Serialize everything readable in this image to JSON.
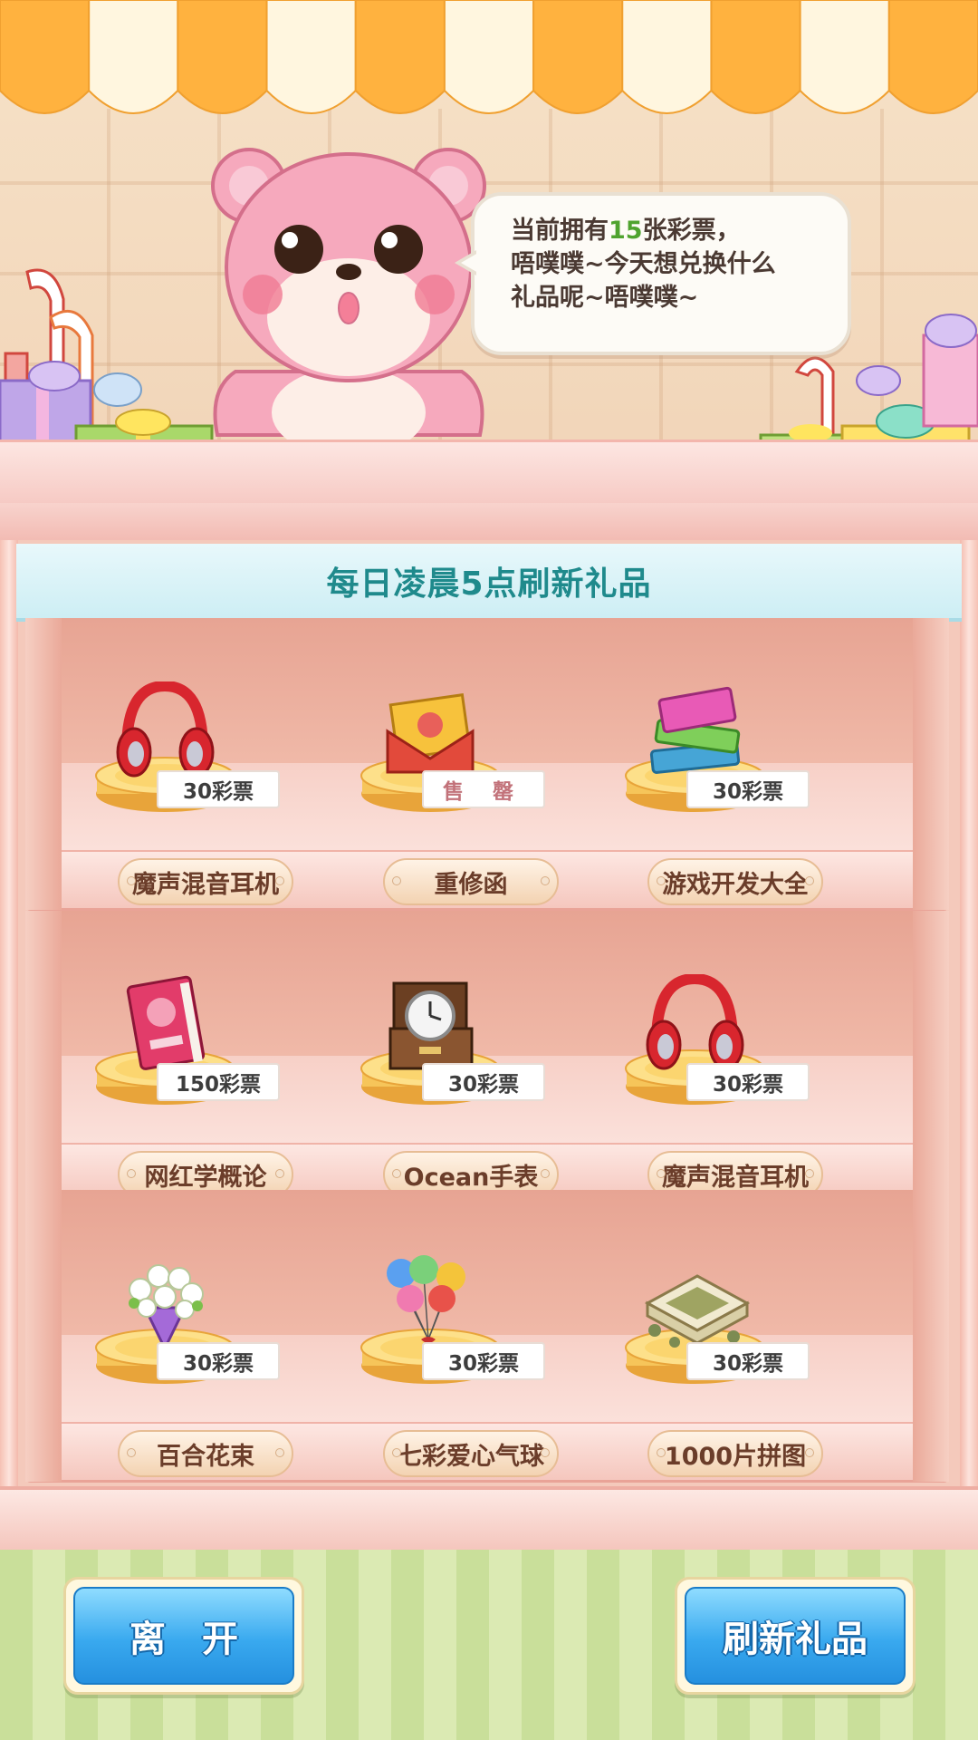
{
  "bubble": {
    "line1_prefix": "当前拥有",
    "ticket_count": "15",
    "line1_suffix": "张彩票，",
    "line2": "唔噗噗~今天想兑换什么",
    "line3": "礼品呢~唔噗噗~"
  },
  "banner": {
    "text": "每日凌晨5点刷新礼品"
  },
  "shelves": [
    {
      "items": [
        {
          "name": "魔声混音耳机",
          "price": "30彩票",
          "icon": "headphones-icon",
          "sold": false
        },
        {
          "name": "重修函",
          "price": "售 罄",
          "icon": "envelope-icon",
          "sold": true
        },
        {
          "name": "游戏开发大全",
          "price": "30彩票",
          "icon": "books-icon",
          "sold": false
        }
      ]
    },
    {
      "items": [
        {
          "name": "网红学概论",
          "price": "150彩票",
          "icon": "book-icon",
          "sold": false
        },
        {
          "name": "Ocean手表",
          "price": "30彩票",
          "icon": "watch-box-icon",
          "sold": false
        },
        {
          "name": "魔声混音耳机",
          "price": "30彩票",
          "icon": "headphones-icon",
          "sold": false
        }
      ]
    },
    {
      "items": [
        {
          "name": "百合花束",
          "price": "30彩票",
          "icon": "bouquet-icon",
          "sold": false
        },
        {
          "name": "七彩爱心气球",
          "price": "30彩票",
          "icon": "balloons-icon",
          "sold": false
        },
        {
          "name": "1000片拼图",
          "price": "30彩票",
          "icon": "puzzle-icon",
          "sold": false
        }
      ]
    }
  ],
  "buttons": {
    "leave": "离　开",
    "refresh": "刷新礼品"
  },
  "colors": {
    "accent_teal": "#1f8a8c",
    "count_green": "#4fa32f",
    "button_blue": "#39a9ef"
  }
}
